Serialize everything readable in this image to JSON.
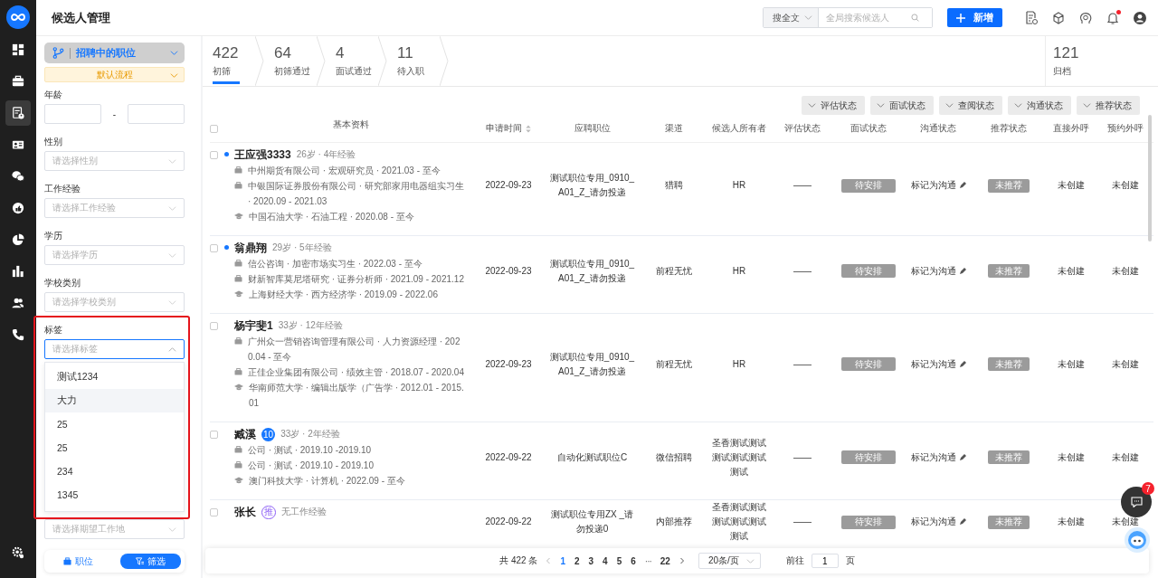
{
  "sidebar": {
    "items": [
      {
        "kind": "dashboard",
        "selected": false
      },
      {
        "kind": "briefcase",
        "selected": false
      },
      {
        "kind": "candidates",
        "selected": true
      },
      {
        "kind": "idcard",
        "selected": false
      },
      {
        "kind": "chat",
        "selected": false
      },
      {
        "kind": "thumb",
        "selected": false
      },
      {
        "kind": "pie",
        "selected": false
      },
      {
        "kind": "bars",
        "selected": false
      },
      {
        "kind": "people",
        "selected": false
      },
      {
        "kind": "phone",
        "selected": false
      }
    ],
    "footer": [
      {
        "kind": "settings",
        "selected": false
      }
    ]
  },
  "header": {
    "title": "候选人管理",
    "search_scope": "搜全文",
    "search": {
      "placeholder": "全局搜索候选人"
    },
    "add_button": "新增",
    "unread_notifications": true
  },
  "filter_panel": {
    "position_select": "招聘中的职位",
    "process": "默认流程",
    "fields": [
      {
        "kind": "range",
        "label": "年龄",
        "separator": "-"
      },
      {
        "kind": "select",
        "label": "性别",
        "placeholder": "请选择性别",
        "expanded": false,
        "highlighted": false
      },
      {
        "kind": "select",
        "label": "工作经验",
        "placeholder": "请选择工作经验",
        "expanded": false,
        "highlighted": false
      },
      {
        "kind": "select",
        "label": "学历",
        "placeholder": "请选择学历",
        "expanded": false,
        "highlighted": false
      },
      {
        "kind": "select",
        "label": "学校类别",
        "placeholder": "请选择学校类别",
        "expanded": false,
        "highlighted": false
      },
      {
        "kind": "select",
        "label": "标签",
        "placeholder": "请选择标签",
        "expanded": true,
        "highlighted": true,
        "options": [
          {
            "label": "测试1234",
            "hovered": false
          },
          {
            "label": "大力",
            "hovered": true
          },
          {
            "label": "25",
            "hovered": false
          },
          {
            "label": "25",
            "hovered": false
          },
          {
            "label": "234",
            "hovered": false
          },
          {
            "label": "1345",
            "hovered": false
          }
        ]
      },
      {
        "kind": "select",
        "placeholder": "请选择期望工作地",
        "expanded": false,
        "highlighted": false
      }
    ],
    "tabs": [
      {
        "label": "职位",
        "kind": "briefcase",
        "selected": false
      },
      {
        "label": "筛选",
        "kind": "filter",
        "selected": true
      }
    ]
  },
  "stages": [
    {
      "count": "422",
      "label": "初筛",
      "selected": true
    },
    {
      "count": "64",
      "label": "初筛通过",
      "selected": false
    },
    {
      "count": "4",
      "label": "面试通过",
      "selected": false
    },
    {
      "count": "11",
      "label": "待入职",
      "selected": false
    }
  ],
  "archive": {
    "count": "121",
    "label": "归档"
  },
  "status_filters": [
    "评估状态",
    "面试状态",
    "查阅状态",
    "沟通状态",
    "推荐状态"
  ],
  "table": {
    "header_checked": false,
    "columns": [
      {
        "label": "基本资料",
        "sortable": false
      },
      {
        "label": "申请时间",
        "sortable": true
      },
      {
        "label": "应聘职位",
        "sortable": false
      },
      {
        "label": "渠道",
        "sortable": false
      },
      {
        "label": "候选人所有者",
        "sortable": false
      },
      {
        "label": "评估状态",
        "sortable": false
      },
      {
        "label": "面试状态",
        "sortable": false
      },
      {
        "label": "沟通状态",
        "sortable": false
      },
      {
        "label": "推荐状态",
        "sortable": false
      },
      {
        "label": "直接外呼",
        "sortable": false
      },
      {
        "label": "预约外呼",
        "sortable": false
      }
    ],
    "rows": [
      {
        "checked": false,
        "unread": true,
        "name": "王应强3333",
        "meta": "26岁 · 4年经验",
        "history": [
          {
            "kind": "work",
            "text": "中州期货有限公司 · 宏观研究员 · 2021.03 - 至今"
          },
          {
            "kind": "work",
            "text": "中银国际证券股份有限公司 · 研究部家用电器组实习生 · 2020.09 - 2021.03"
          },
          {
            "kind": "edu",
            "text": "中国石油大学 · 石油工程 · 2020.08 - 至今"
          }
        ],
        "apply_date": "2022-09-23",
        "position": "测试职位专用_0910_A01_Z_请勿投递",
        "channel": "猎聘",
        "owner": "HR",
        "evaluation": "——",
        "interview": "待安排",
        "communication": "标记为沟通",
        "recommendation": "未推荐",
        "direct_call": "未创建",
        "scheduled_call": "未创建"
      },
      {
        "checked": false,
        "unread": true,
        "name": "翁鼎翔",
        "meta": "29岁 · 5年经验",
        "history": [
          {
            "kind": "work",
            "text": "信公咨询 · 加密市场实习生 · 2022.03 - 至今"
          },
          {
            "kind": "work",
            "text": "财新智库莫尼塔研究 · 证券分析师 · 2021.09 - 2021.12"
          },
          {
            "kind": "edu",
            "text": "上海财经大学 · 西方经济学 · 2019.09 - 2022.06"
          }
        ],
        "apply_date": "2022-09-23",
        "position": "测试职位专用_0910_A01_Z_请勿投递",
        "channel": "前程无忧",
        "owner": "HR",
        "evaluation": "——",
        "interview": "待安排",
        "communication": "标记为沟通",
        "recommendation": "未推荐",
        "direct_call": "未创建",
        "scheduled_call": "未创建"
      },
      {
        "checked": false,
        "unread": false,
        "name": "杨宇斐1",
        "meta": "33岁 · 12年经验",
        "history": [
          {
            "kind": "work",
            "text": "广州众一营销咨询管理有限公司 · 人力资源经理 · 2020.04 - 至今"
          },
          {
            "kind": "work",
            "text": "正佳企业集团有限公司 · 绩效主管 · 2018.07 - 2020.04"
          },
          {
            "kind": "edu",
            "text": "华南师范大学 · 编辑出版学（广告学 · 2012.01 - 2015.01"
          }
        ],
        "apply_date": "2022-09-23",
        "position": "测试职位专用_0910_A01_Z_请勿投递",
        "channel": "前程无忧",
        "owner": "HR",
        "evaluation": "——",
        "interview": "待安排",
        "communication": "标记为沟通",
        "recommendation": "未推荐",
        "direct_call": "未创建",
        "scheduled_call": "未创建"
      },
      {
        "checked": false,
        "unread": false,
        "name": "臧溪",
        "badge": {
          "kind": "count",
          "text": "10"
        },
        "meta": "33岁 · 2年经验",
        "history": [
          {
            "kind": "work",
            "text": "公司 · 测试 · 2019.10 -2019.10"
          },
          {
            "kind": "work",
            "text": "公司 · 测试 · 2019.10 - 2019.10"
          },
          {
            "kind": "edu",
            "text": "澳门科技大学 · 计算机 · 2022.09 - 至今"
          }
        ],
        "apply_date": "2022-09-22",
        "position": "自动化测试职位C",
        "channel": "微信招聘",
        "owner": "圣香测试测试测试测试测试测试",
        "evaluation": "——",
        "interview": "待安排",
        "communication": "标记为沟通",
        "recommendation": "未推荐",
        "direct_call": "未创建",
        "scheduled_call": "未创建"
      },
      {
        "checked": false,
        "unread": false,
        "name": "张长",
        "badge": {
          "kind": "tag",
          "text": "推"
        },
        "meta": "无工作经验",
        "history": [],
        "apply_date": "2022-09-22",
        "position": "测试职位专用ZX _请勿投递0",
        "channel": "内部推荐",
        "owner": "圣香测试测试测试测试测试测试",
        "evaluation": "——",
        "interview": "待安排",
        "communication": "标记为沟通",
        "recommendation": "未推荐",
        "direct_call": "未创建",
        "scheduled_call": "未创建"
      }
    ]
  },
  "pagination": {
    "total": "共 422 条",
    "pages": [
      {
        "kind": "page",
        "label": "1",
        "selected": true
      },
      {
        "kind": "page",
        "label": "2",
        "selected": false
      },
      {
        "kind": "page",
        "label": "3",
        "selected": false
      },
      {
        "kind": "page",
        "label": "4",
        "selected": false
      },
      {
        "kind": "page",
        "label": "5",
        "selected": false
      },
      {
        "kind": "page",
        "label": "6",
        "selected": false
      },
      {
        "kind": "ellipsis",
        "label": "···",
        "selected": false
      },
      {
        "kind": "page",
        "label": "22",
        "selected": false
      }
    ],
    "page_size": "20条/页",
    "goto_label": "前往",
    "goto_value": "1",
    "page_suffix": "页"
  },
  "chat_button": {
    "badge": "7"
  }
}
